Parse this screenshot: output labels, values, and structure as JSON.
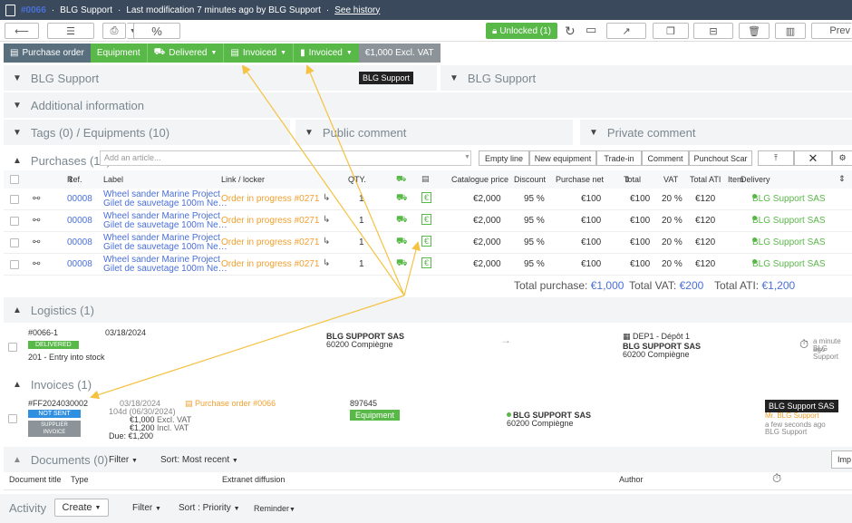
{
  "titlebar": {
    "ref": "#0066",
    "company": "BLG Support",
    "modification": "Last modification 7 minutes ago by BLG Support",
    "history_link": "See history"
  },
  "toolbar": {
    "percent": "%",
    "unlock": "Unlocked (1)",
    "preview": "Prev"
  },
  "status": {
    "purchase_order": "Purchase order",
    "equipment": "Equipment",
    "delivered": "Delivered",
    "invoiced1": "Invoiced",
    "invoiced2": "Invoiced",
    "amount": "€1,000 Excl. VAT"
  },
  "sections": {
    "supplier": "BLG Support",
    "supplier_badge": "BLG Support",
    "supplier2": "BLG Support",
    "additional": "Additional information",
    "tags": "Tags (0) / Equipments (10)",
    "public_comment": "Public comment",
    "private_comment": "Private comment",
    "purchases": "Purchases (10)",
    "logistics": "Logistics (1)",
    "invoices": "Invoices (1)",
    "documents": "Documents (0)"
  },
  "purchases": {
    "search_placeholder": "Add an article...",
    "buttons": [
      "Empty line",
      "New equipment",
      "Trade-in",
      "Comment",
      "Punchout Scar"
    ],
    "headers": {
      "ref": "Ref.",
      "label": "Label",
      "link": "Link / locker",
      "qty": "QTY.",
      "catalogue": "Catalogue price",
      "discount": "Discount",
      "net": "Purchase net",
      "total": "Total",
      "vat": "VAT",
      "total_ati": "Total ATI",
      "item": "Item",
      "delivery": "Delivery"
    },
    "rows": [
      {
        "ref": "00008",
        "label1": "Wheel sander Marine Project",
        "label2": "Gilet de sauvetage 100m Ne…",
        "link": "Order in progress #0271",
        "qty": "1",
        "catalogue": "€2,000",
        "discount": "95 %",
        "net": "€100",
        "total": "€100",
        "vat": "20 %",
        "ati": "€120",
        "delivery": "BLG Support SAS"
      },
      {
        "ref": "00008",
        "label1": "Wheel sander Marine Project",
        "label2": "Gilet de sauvetage 100m Ne…",
        "link": "Order in progress #0271",
        "qty": "1",
        "catalogue": "€2,000",
        "discount": "95 %",
        "net": "€100",
        "total": "€100",
        "vat": "20 %",
        "ati": "€120",
        "delivery": "BLG Support SAS"
      },
      {
        "ref": "00008",
        "label1": "Wheel sander Marine Project",
        "label2": "Gilet de sauvetage 100m Ne…",
        "link": "Order in progress #0271",
        "qty": "1",
        "catalogue": "€2,000",
        "discount": "95 %",
        "net": "€100",
        "total": "€100",
        "vat": "20 %",
        "ati": "€120",
        "delivery": "BLG Support SAS"
      },
      {
        "ref": "00008",
        "label1": "Wheel sander Marine Project",
        "label2": "Gilet de sauvetage 100m Ne…",
        "link": "Order in progress #0271",
        "qty": "1",
        "catalogue": "€2,000",
        "discount": "95 %",
        "net": "€100",
        "total": "€100",
        "vat": "20 %",
        "ati": "€120",
        "delivery": "BLG Support SAS"
      }
    ],
    "totals": {
      "purchase_label": "Total purchase:",
      "purchase": "€1,000",
      "vat_label": "Total VAT:",
      "vat": "€200",
      "ati_label": "Total ATI:",
      "ati": "€1,200"
    }
  },
  "logistics": {
    "ref": "#0066-1",
    "status": "DELIVERED",
    "entry": "201 - Entry into stock",
    "date": "03/18/2024",
    "from_name": "BLG SUPPORT SAS",
    "from_city": "60200 Compiègne",
    "arrow": "→",
    "depot": "DEP1 - Dépôt 1",
    "to_name": "BLG SUPPORT SAS",
    "to_city": "60200 Compiègne",
    "time": "a minute ago",
    "by": "BLG Support"
  },
  "invoice": {
    "ref": "#FF2024030002",
    "status": "NOT SENT",
    "type": "SUPPLIER INVOICE",
    "date": "03/18/2024",
    "due_info": "104d (06/30/2024)",
    "excl": "€1,000",
    "excl_label": "Excl. VAT",
    "incl": "€1,200",
    "incl_label": "Incl. VAT",
    "due": "Due: €1,200",
    "po_link": "Purchase order #0066",
    "number": "897645",
    "tag": "Equipment",
    "supplier_name": "BLG SUPPORT SAS",
    "supplier_city": "60200 Compiègne",
    "badge": "BLG Support SAS",
    "contact": "Mr. BLG Support",
    "time": "a few seconds ago",
    "by": "BLG Support"
  },
  "documents": {
    "filter": "Filter",
    "sort": "Sort: Most recent",
    "import": "Imp",
    "col_title": "Document title",
    "col_type": "Type",
    "col_extranet": "Extranet diffusion",
    "col_author": "Author"
  },
  "activity": {
    "title": "Activity",
    "create": "Create",
    "filter": "Filter",
    "sort": "Sort : Priority",
    "reminder": "Reminder"
  },
  "colors": {
    "green": "#58b848",
    "header": "#3a4a5c",
    "link": "#4a6fd8",
    "orange": "#f0a030",
    "arrow": "#f5c242"
  }
}
